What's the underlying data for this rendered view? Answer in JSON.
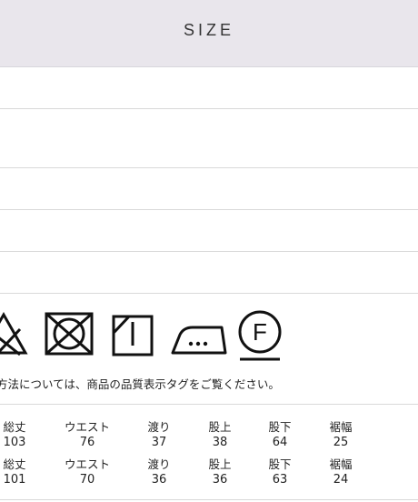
{
  "header": {
    "title": "SIZE"
  },
  "care": {
    "icons": [
      "bleach-not-allowed-icon",
      "do-not-tumble-dry-icon",
      "drip-dry-icon",
      "iron-medium-icon",
      "dry-clean-f-icon"
    ],
    "note": "方法については、商品の品質表示タグをご覧ください。"
  },
  "sizes": {
    "rows": [
      {
        "labels": [
          "総丈",
          "ウエスト",
          "渡り",
          "股上",
          "股下",
          "裾幅"
        ],
        "values": [
          "103",
          "76",
          "37",
          "38",
          "64",
          "25"
        ]
      },
      {
        "labels": [
          "総丈",
          "ウエスト",
          "渡り",
          "股上",
          "股下",
          "裾幅"
        ],
        "values": [
          "101",
          "70",
          "36",
          "36",
          "63",
          "24"
        ]
      }
    ]
  }
}
